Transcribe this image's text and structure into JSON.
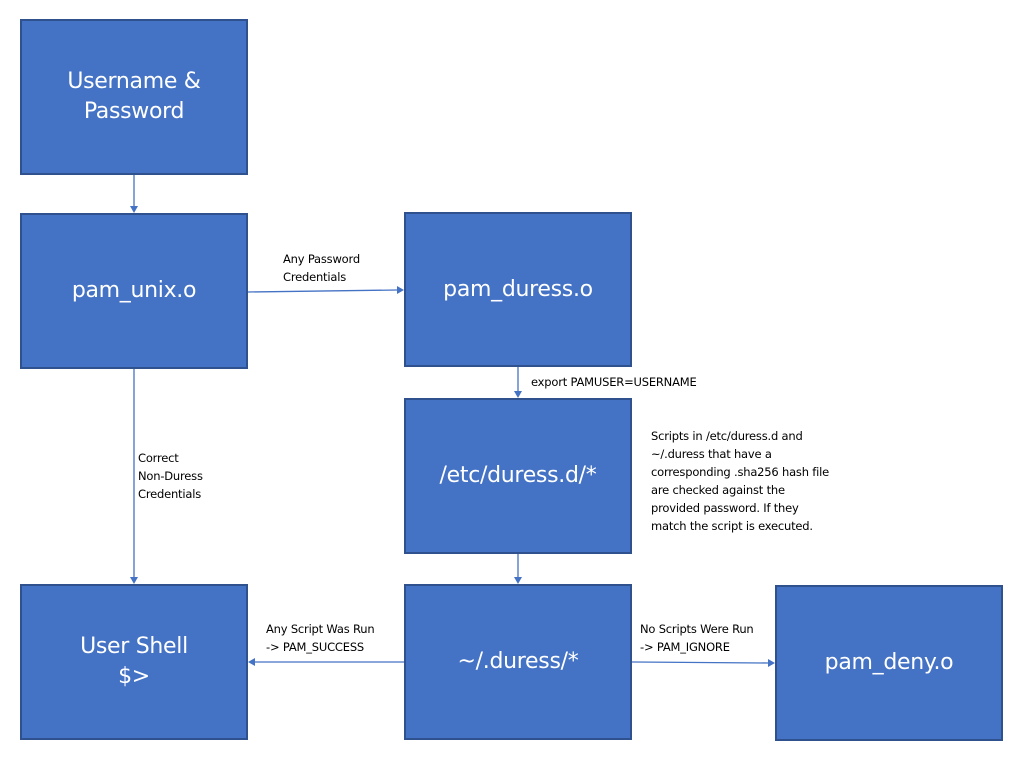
{
  "diagram": {
    "title": "",
    "colors": {
      "node_fill": "#4472C4",
      "node_border": "#2F528F",
      "node_text": "#FFFFFF",
      "edge": "#4472C4",
      "label_text": "#000000",
      "background": "#FFFFFF"
    },
    "nodes": {
      "credentials": {
        "lines": [
          "Username &",
          "Password"
        ]
      },
      "pam_unix": {
        "lines": [
          "pam_unix.o"
        ]
      },
      "pam_duress": {
        "lines": [
          "pam_duress.o"
        ]
      },
      "etc_duress": {
        "lines": [
          "/etc/duress.d/*"
        ]
      },
      "home_duress": {
        "lines": [
          "~/.duress/*"
        ]
      },
      "user_shell": {
        "lines": [
          "User Shell",
          "$>"
        ]
      },
      "pam_deny": {
        "lines": [
          "pam_deny.o"
        ]
      }
    },
    "edges": [
      {
        "from": "credentials",
        "to": "pam_unix",
        "label": []
      },
      {
        "from": "pam_unix",
        "to": "pam_duress",
        "label": [
          "Any Password",
          "Credentials"
        ]
      },
      {
        "from": "pam_unix",
        "to": "user_shell",
        "label": [
          "Correct",
          "Non-Duress",
          "Credentials"
        ]
      },
      {
        "from": "pam_duress",
        "to": "etc_duress",
        "label": [
          "export PAMUSER=USERNAME"
        ]
      },
      {
        "from": "etc_duress",
        "to": "home_duress",
        "label": []
      },
      {
        "from": "home_duress",
        "to": "user_shell",
        "label": [
          "Any Script Was Run",
          "-> PAM_SUCCESS"
        ]
      },
      {
        "from": "home_duress",
        "to": "pam_deny",
        "label": [
          "No Scripts Were Run",
          "-> PAM_IGNORE"
        ]
      }
    ],
    "annotations": {
      "scripts_note": [
        "Scripts in /etc/duress.d and",
        "~/.duress that have a",
        "corresponding .sha256 hash file",
        "are checked against the",
        "provided password. If they",
        "match the script is executed."
      ]
    }
  }
}
